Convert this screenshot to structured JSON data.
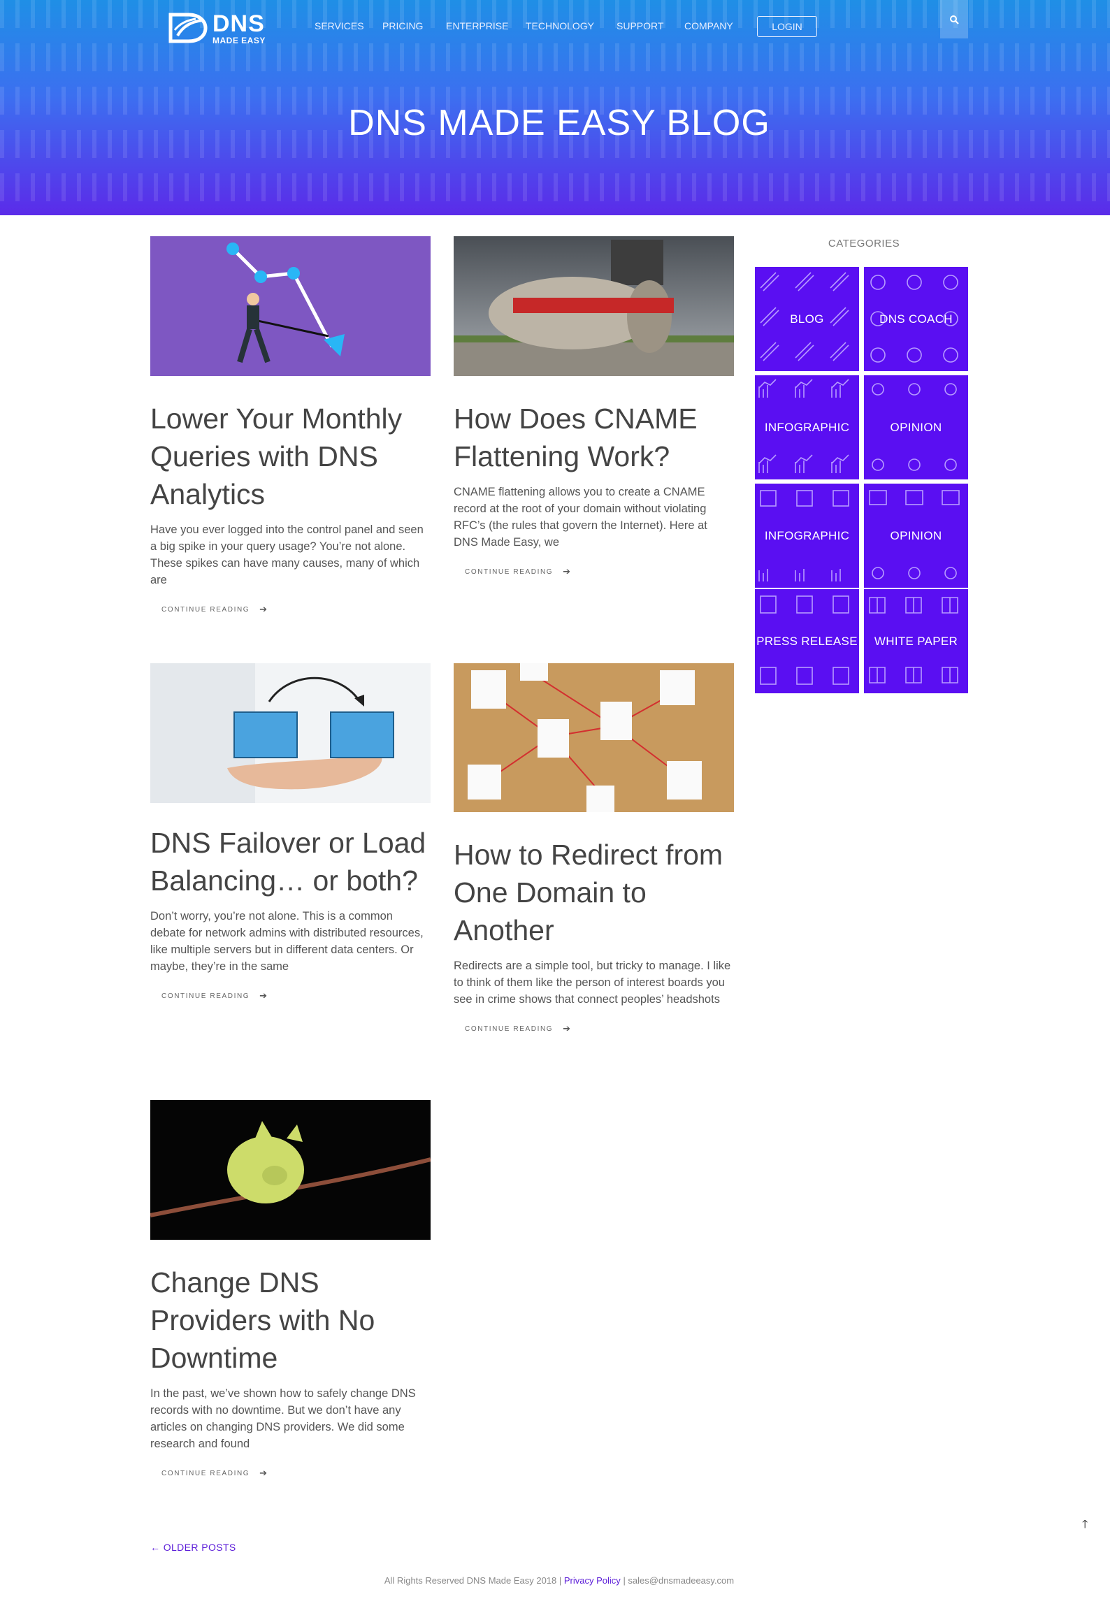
{
  "header": {
    "logo_big": "DNS",
    "logo_small": "MADE EASY",
    "nav": [
      "SERVICES",
      "PRICING",
      "ENTERPRISE",
      "TECHNOLOGY",
      "SUPPORT",
      "COMPANY"
    ],
    "login_label": "LOGIN",
    "search_icon": "search-icon",
    "hero_title": "DNS MADE EASY BLOG"
  },
  "posts": [
    {
      "title": "Lower Your Monthly Queries with DNS Analytics",
      "excerpt": "Have you ever logged into the control panel and seen a big spike in your query usage? You’re not alone. These spikes can have many causes, many of which are",
      "cta": "CONTINUE READING"
    },
    {
      "title": "How Does CNAME Flattening Work?",
      "excerpt": "CNAME flattening allows you to create a CNAME record at the root of your domain without violating RFC’s (the rules that govern the Internet). Here at DNS Made Easy, we",
      "cta": "CONTINUE READING"
    },
    {
      "title": "DNS Failover or Load Balancing… or both?",
      "excerpt": "Don’t worry, you’re not alone. This is a common debate for network admins with distributed resources, like multiple servers but in different data centers. Or maybe, they’re in the same",
      "cta": "CONTINUE READING"
    },
    {
      "title": "How to Redirect from One Domain to Another",
      "excerpt": "Redirects are a simple tool, but tricky to manage. I like to think of them like the person of interest boards you see in crime shows that connect peoples’ headshots",
      "cta": "CONTINUE READING"
    },
    {
      "title": "Change DNS Providers with No Downtime",
      "excerpt": "In the past, we’ve shown how to safely change DNS records with no downtime. But we don’t have any articles on changing DNS providers. We did some research and found",
      "cta": "CONTINUE READING"
    }
  ],
  "sidebar": {
    "title": "CATEGORIES",
    "categories": [
      "BLOG",
      "DNS COACH",
      "INFOGRAPHIC",
      "OPINION",
      "INFOGRAPHIC",
      "OPINION",
      "PRESS RELEASE",
      "WHITE PAPER"
    ]
  },
  "pagination": {
    "older": "← OLDER POSTS"
  },
  "footer": {
    "copyright": "All Rights Reserved DNS Made Easy 2018 |",
    "privacy": "Privacy Policy",
    "email": "| sales@dnsmadeeasy.com"
  },
  "colors": {
    "accent": "#5a0ff2",
    "hero_top": "#1f8fe6",
    "hero_bottom": "#5b2be9"
  }
}
